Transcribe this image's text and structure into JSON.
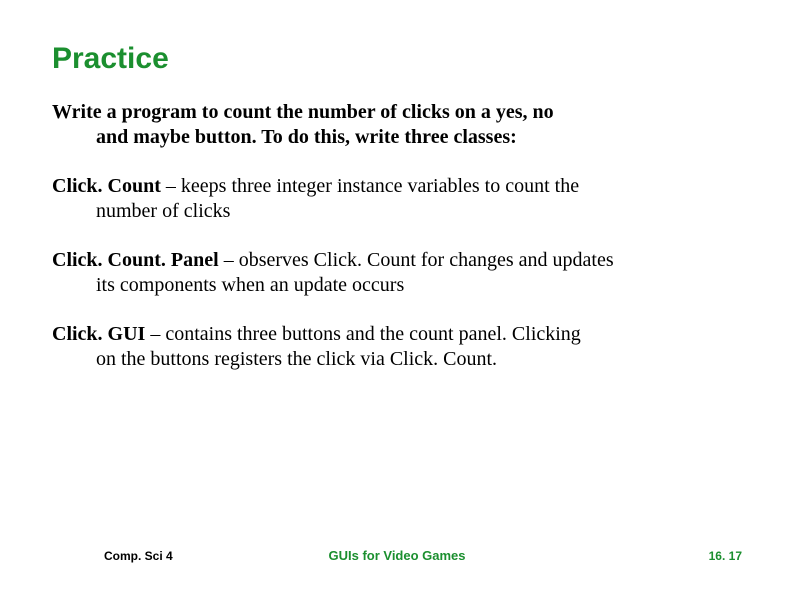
{
  "title": "Practice",
  "intro_line1": "Write a program to count the number of clicks on a yes, no",
  "intro_line2": "and maybe button.  To do this, write three classes:",
  "p1_bold": "Click. Count ",
  "p1_rest1": "– keeps three integer instance variables to count the",
  "p1_rest2": "number of clicks",
  "p2_bold": "Click. Count. Panel ",
  "p2_rest1": "– observes Click. Count for changes and updates",
  "p2_rest2": "its components when an update occurs",
  "p3_bold": "Click. GUI ",
  "p3_rest1": "– contains three buttons and the count panel.  Clicking",
  "p3_rest2": "on the buttons registers the click via Click. Count.",
  "footer_left": "Comp. Sci 4",
  "footer_center": "GUIs for Video Games",
  "footer_right": "16. 17"
}
